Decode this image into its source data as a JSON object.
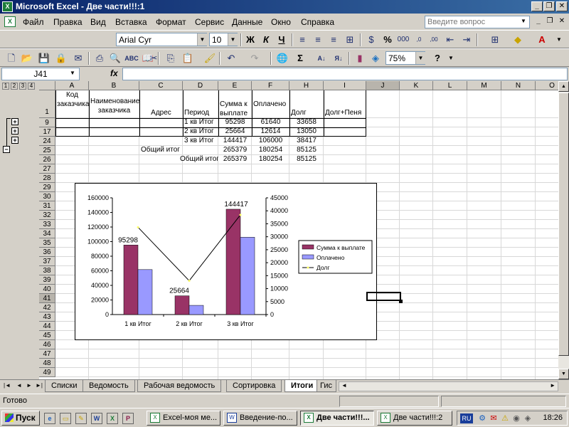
{
  "window": {
    "title": "Microsoft Excel - Две части!!!:1",
    "minimize": "_",
    "restore": "❐",
    "close": "✕"
  },
  "menu": {
    "items": [
      "Файл",
      "Правка",
      "Вид",
      "Вставка",
      "Формат",
      "Сервис",
      "Данные",
      "Окно",
      "Справка"
    ],
    "help_placeholder": "Введите вопрос"
  },
  "format_toolbar": {
    "font": "Arial Cyr",
    "size": "10",
    "bold": "Ж",
    "italic": "К",
    "underline": "Ч"
  },
  "standard_toolbar": {
    "zoom": "75%"
  },
  "formula_bar": {
    "name_box": "J41",
    "fx": "fx",
    "value": ""
  },
  "outline": {
    "levels": [
      "1",
      "2",
      "3",
      "4"
    ],
    "expand": "+",
    "collapse": "−"
  },
  "columns": [
    "A",
    "B",
    "C",
    "D",
    "E",
    "F",
    "H",
    "I",
    "J",
    "K",
    "L",
    "M",
    "N",
    "O"
  ],
  "rows": [
    "1",
    "9",
    "17",
    "24",
    "25",
    "26",
    "27",
    "28",
    "29",
    "30",
    "31",
    "32",
    "33",
    "34",
    "35",
    "36",
    "37",
    "38",
    "39",
    "40",
    "41",
    "42",
    "43",
    "44",
    "45",
    "46",
    "47",
    "48",
    "49"
  ],
  "headers": {
    "a": "Код заказчика",
    "b": "Наименование заказчика",
    "c": "Адрес",
    "d": "Период",
    "e": "Сумма к выплате",
    "f": "Оплачено",
    "h": "Долг",
    "i": "Долг+Пеня"
  },
  "table": [
    {
      "c": "",
      "d": "1 кв Итог",
      "e": "95298",
      "f": "61640",
      "h": "33658"
    },
    {
      "c": "",
      "d": "2 кв Итог",
      "e": "25664",
      "f": "12614",
      "h": "13050"
    },
    {
      "c": "",
      "d": "3 кв Итог",
      "e": "144417",
      "f": "106000",
      "h": "38417"
    },
    {
      "c": "Общий итог",
      "d": "",
      "e": "265379",
      "f": "180254",
      "h": "85125"
    },
    {
      "c": "",
      "d": "Общий итог",
      "e": "265379",
      "f": "180254",
      "h": "85125"
    }
  ],
  "chart_data": {
    "type": "bar",
    "categories": [
      "1 кв  Итог",
      "2 кв  Итог",
      "3 кв  Итог"
    ],
    "series": [
      {
        "name": "Сумма к выплате",
        "values": [
          95298,
          25664,
          144417
        ],
        "axis": "left",
        "kind": "bar",
        "color": "#993366"
      },
      {
        "name": "Оплачено",
        "values": [
          61640,
          12614,
          106000
        ],
        "axis": "left",
        "kind": "bar",
        "color": "#9999ff"
      },
      {
        "name": "Долг",
        "values": [
          33658,
          13050,
          38417
        ],
        "axis": "right",
        "kind": "line",
        "color": "#000000"
      }
    ],
    "data_labels": [
      "95298",
      "25664",
      "144417"
    ],
    "y_left_ticks": [
      "0",
      "20000",
      "40000",
      "60000",
      "80000",
      "100000",
      "120000",
      "140000",
      "160000"
    ],
    "y_right_ticks": [
      "0",
      "5000",
      "10000",
      "15000",
      "20000",
      "25000",
      "30000",
      "35000",
      "40000",
      "45000"
    ],
    "ylim_left": [
      0,
      160000
    ],
    "ylim_right": [
      0,
      45000
    ],
    "legend_position": "right",
    "grid": false
  },
  "sheet_tabs": [
    "Списки",
    "Ведомость",
    "Рабочая ведомость",
    "Сортировка",
    "Итоги",
    "Гис"
  ],
  "active_tab": "Итоги",
  "tab_nav": [
    "|◄",
    "◄",
    "►",
    "►|"
  ],
  "status": {
    "text": "Готово"
  },
  "taskbar": {
    "start": "Пуск",
    "buttons": [
      "Excel-моя ме...",
      "Введение-по...",
      "Две части!!!...",
      "Две части!!!:2"
    ],
    "lang": "RU",
    "clock": "18:26"
  }
}
